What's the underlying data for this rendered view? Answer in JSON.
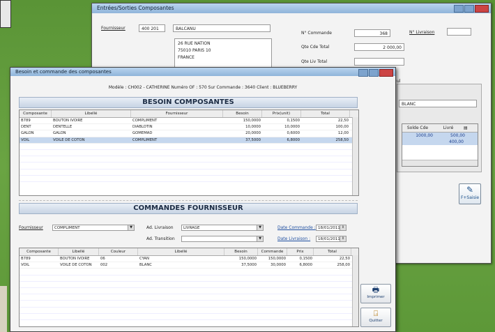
{
  "back_window": {
    "title": "Entrées/Sorties Composantes",
    "fournisseur_label": "Fournisseur",
    "fournisseur_code": "400 201",
    "fournisseur_name": "BALCANU",
    "address": [
      "26 RUE NATION",
      "75010 PARIS 10",
      "FRANCE"
    ],
    "n_commande_label": "N° Commande",
    "n_commande_value": "368",
    "n_livraison_label": "N° Livraison",
    "qte_cde_total_label": "Qte Cde Total",
    "qte_cde_total_value": "2 000,00",
    "qte_liv_total_label": "Qte Liv Total",
    "right_field": "BLANC",
    "right_label_cut": "ul",
    "mini_grid_headers": [
      "Solde Cde",
      "Livré"
    ],
    "mini_grid_rows": [
      [
        "1000,00",
        "500,00"
      ],
      [
        "",
        "400,00"
      ]
    ],
    "fsaisie_label": "F+Saisie"
  },
  "front_window": {
    "title": "Besoin et commande des composantes",
    "info": "Modèle : CH002 - CATHERINE     Numéro OF : 570 Sur Commande : 3640 Client : BLUEBERRY",
    "besoin_title": "BESOIN COMPOSANTES",
    "besoin_headers": [
      "Composante",
      "Libellé",
      "Fournisseur",
      "Besoin",
      "Prix(unit)",
      "Total"
    ],
    "besoin_rows": [
      [
        "B789",
        "BOUTON IVOIRE",
        "COMPLIMENT",
        "150,0000",
        "0,1500",
        "22,50"
      ],
      [
        "DENT",
        "DENTELLE",
        "DIABLOTIN",
        "10,0000",
        "10,0000",
        "100,00"
      ],
      [
        "GALON",
        "GALON",
        "GOMEMAD",
        "20,0000",
        "0,6000",
        "12,00"
      ],
      [
        "VOIL",
        "VOILE DE COTON",
        "COMPLIMENT",
        "37,5000",
        "6,8000",
        "258,50"
      ]
    ],
    "commandes_title": "COMMANDES FOURNISSEUR",
    "fournisseur_label": "Fournisseur",
    "fournisseur_value": "COMPLIMENT",
    "ad_livraison_label": "Ad. Livraison",
    "ad_livraison_value": "LIVRAGE",
    "ad_transition_label": "Ad. Transition",
    "date_commande_label": "Date Commande :",
    "date_commande_value": "18/01/2011",
    "date_livraison_label": "Date Livraison :",
    "date_livraison_value": "18/01/2011",
    "cmd_headers": [
      "Composante",
      "Libellé",
      "Couleur",
      "Libellé",
      "Besoin",
      "Commande",
      "Prix",
      "Total"
    ],
    "cmd_rows": [
      [
        "B789",
        "BOUTON IVOIRE",
        "06",
        "CYAN",
        "150,0000",
        "150,0000",
        "0,1500",
        "22,50"
      ],
      [
        "VOIL",
        "VOILE DE COTON",
        "002",
        "BLANC",
        "37,5000",
        "30,0000",
        "6,8000",
        "258,00"
      ]
    ],
    "imprimer_label": "Imprimer",
    "quitter_label": "Quitter"
  }
}
